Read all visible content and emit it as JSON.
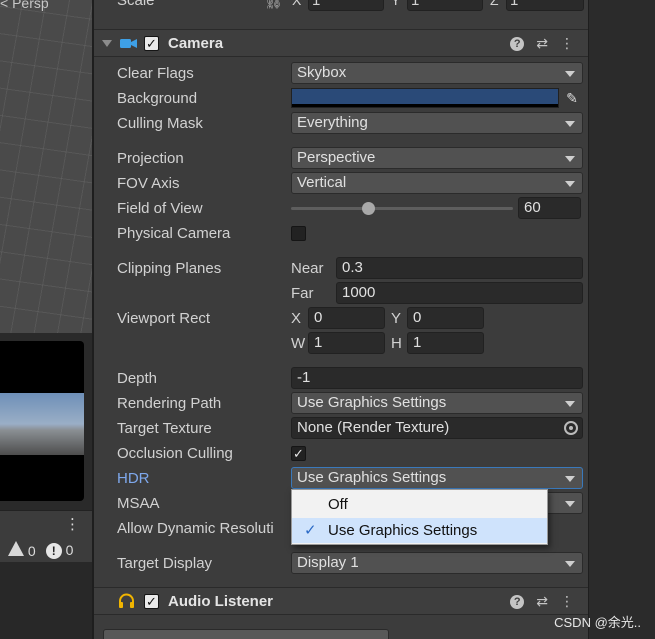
{
  "scene": {
    "label": "< Persp"
  },
  "console": {
    "warning_count": "0",
    "error_count": "0"
  },
  "transform": {
    "scale_label": "Scale",
    "x_label": "X",
    "x_value": "1",
    "y_label": "Y",
    "y_value": "1",
    "z_label": "Z",
    "z_value": "1"
  },
  "camera": {
    "title": "Camera",
    "clear_flags": {
      "label": "Clear Flags",
      "value": "Skybox"
    },
    "background": {
      "label": "Background",
      "color": "#2a4a78"
    },
    "culling_mask": {
      "label": "Culling Mask",
      "value": "Everything"
    },
    "projection": {
      "label": "Projection",
      "value": "Perspective"
    },
    "fov_axis": {
      "label": "FOV Axis",
      "value": "Vertical"
    },
    "field_of_view": {
      "label": "Field of View",
      "value": "60",
      "slider_fraction": 0.35
    },
    "physical_camera": {
      "label": "Physical Camera"
    },
    "clipping": {
      "label": "Clipping Planes",
      "near_label": "Near",
      "near": "0.3",
      "far_label": "Far",
      "far": "1000"
    },
    "viewport": {
      "label": "Viewport Rect",
      "x_label": "X",
      "x": "0",
      "y_label": "Y",
      "y": "0",
      "w_label": "W",
      "w": "1",
      "h_label": "H",
      "h": "1"
    },
    "depth": {
      "label": "Depth",
      "value": "-1"
    },
    "rendering_path": {
      "label": "Rendering Path",
      "value": "Use Graphics Settings"
    },
    "target_texture": {
      "label": "Target Texture",
      "value": "None (Render Texture)"
    },
    "occlusion_culling": {
      "label": "Occlusion Culling"
    },
    "hdr": {
      "label": "HDR",
      "value": "Use Graphics Settings"
    },
    "msaa": {
      "label": "MSAA"
    },
    "dynamic_resolution": {
      "label": "Allow Dynamic Resoluti"
    },
    "target_display": {
      "label": "Target Display",
      "value": "Display 1"
    }
  },
  "hdr_menu": {
    "options": [
      "Off",
      "Use Graphics Settings"
    ],
    "selected": "Use Graphics Settings"
  },
  "audio_listener": {
    "title": "Audio Listener"
  },
  "watermark": "CSDN @余光.."
}
